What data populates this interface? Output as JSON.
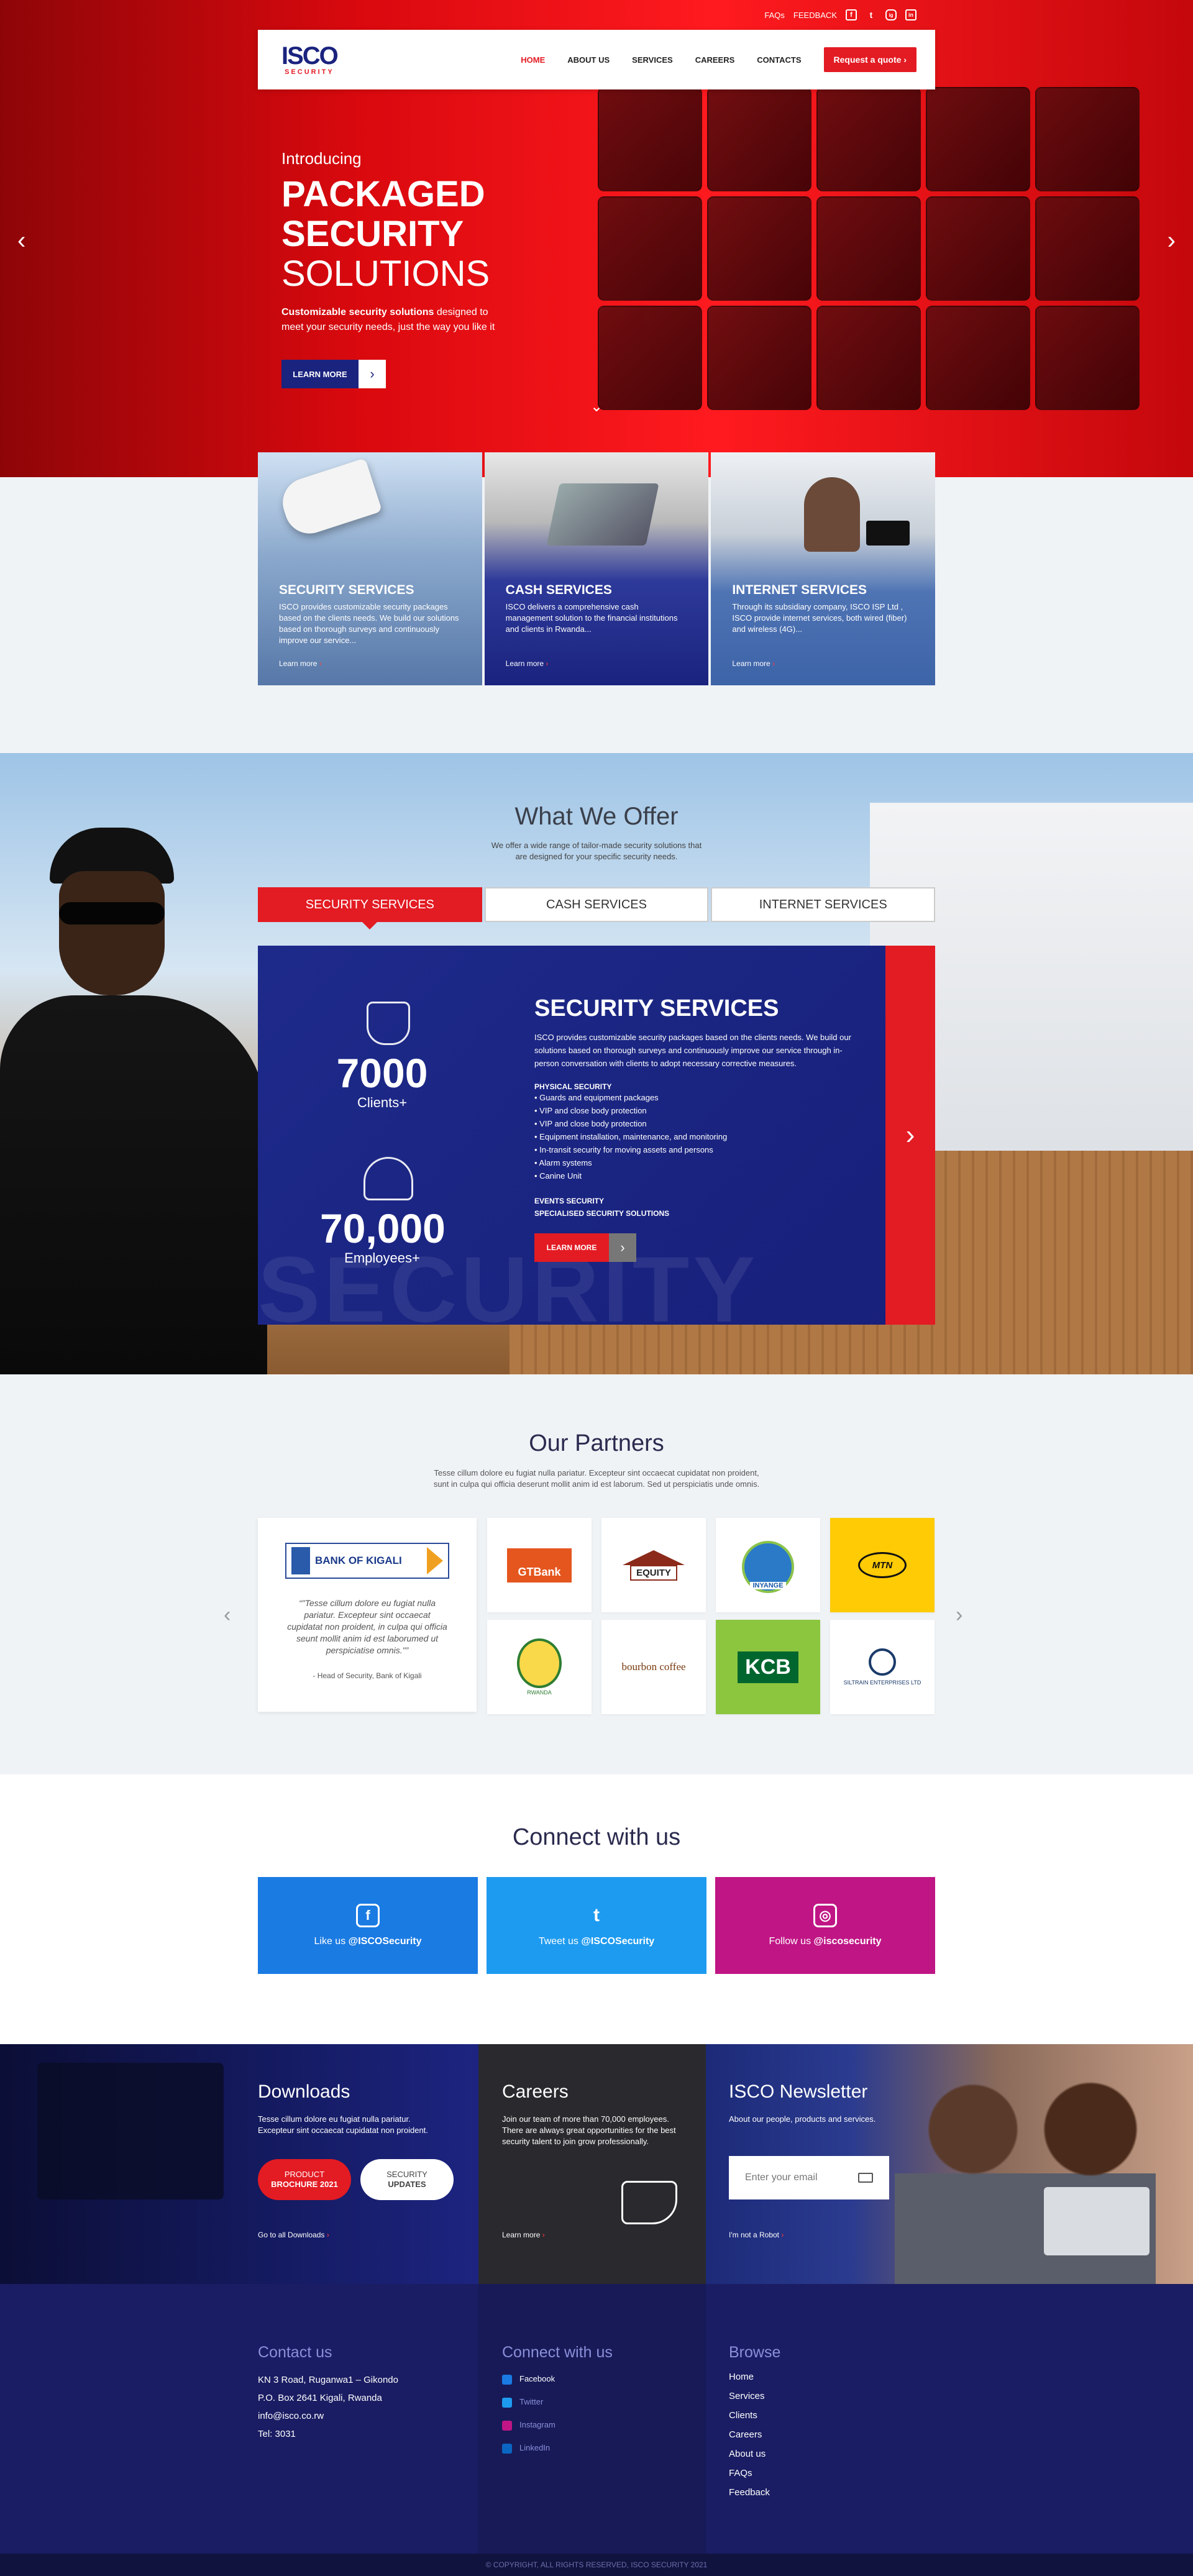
{
  "topbar": {
    "faqs": "FAQs",
    "feedback": "FEEDBACK",
    "social": [
      "f",
      "t",
      "ig",
      "in"
    ]
  },
  "nav": {
    "logo_main": "ISCO",
    "logo_sub": "SECURITY",
    "items": [
      "HOME",
      "ABOUT US",
      "SERVICES",
      "CAREERS",
      "CONTACTS"
    ],
    "active": "HOME",
    "quote": "Request a quote ›"
  },
  "hero": {
    "intro": "Introducing",
    "line1": "PACKAGED",
    "line2": "SECURITY",
    "line3": "SOLUTIONS",
    "desc_bold": "Customizable security solutions",
    "desc_rest": " designed to meet your security needs, just the way you like it",
    "cta": "LEARN MORE",
    "cta_arrow": "›",
    "prev": "‹",
    "next": "›",
    "down": "⌄"
  },
  "cards": [
    {
      "title": "SECURITY SERVICES",
      "text": "ISCO provides customizable security packages based on the clients needs. We build our solutions based on thorough surveys and continuously improve our service...",
      "link": "Learn more",
      "bg": "#6f8fb8"
    },
    {
      "title": "CASH SERVICES",
      "text": "ISCO delivers a comprehensive cash management solution to the financial institutions and clients in Rwanda...",
      "link": "Learn more",
      "bg": "#1a237e"
    },
    {
      "title": "INTERNET SERVICES",
      "text": "Through its subsidiary company, ISCO ISP Ltd , ISCO provide internet services, both wired (fiber) and wireless (4G)...",
      "link": "Learn more",
      "bg": "#3d63a8"
    }
  ],
  "offer": {
    "title": "What We Offer",
    "sub1": "We offer a wide range of tailor-made security solutions that",
    "sub2": "are designed for your specific security needs.",
    "tabs": [
      "SECURITY SERVICES",
      "CASH SERVICES",
      "INTERNET SERVICES"
    ],
    "active_tab": 0,
    "stats": [
      {
        "n": "7000",
        "l": "Clients+"
      },
      {
        "n": "70,000",
        "l": "Employees+"
      }
    ],
    "panel_title": "SECURITY SERVICES",
    "panel_text": "ISCO provides customizable security packages based on the clients needs. We build our solutions based on thorough surveys and continuously improve our service through in-person conversation with clients to adopt necessary corrective measures.",
    "physical_title": "PHYSICAL SECURITY",
    "physical_items": [
      "• Guards and equipment packages",
      "• VIP and close body protection",
      "• VIP and close body protection",
      "• Equipment installation, maintenance, and monitoring",
      "• In-transit security for moving assets and persons",
      "• Alarm systems",
      "• Canine Unit"
    ],
    "events": "EVENTS SECURITY",
    "special": "SPECIALISED SECURITY SOLUTIONS",
    "btn": "LEARN MORE",
    "btn_arrow": "›",
    "next": "›",
    "watermark": "SECURITY"
  },
  "partners": {
    "title": "Our Partners",
    "sub1": "Tesse cillum dolore eu fugiat nulla pariatur. Excepteur sint occaecat cupidatat non proident,",
    "sub2": "sunt in culpa qui officia deserunt mollit anim id est laborum. Sed ut perspiciatis unde omnis.",
    "featured": "BANK OF KIGALI",
    "quote": "\"Tesse cillum dolore eu fugiat nulla pariatur. Excepteur sint occaecat cupidatat non proident, in culpa qui officia seunt mollit anim id est laborumed ut perspiciatise omnis.\"",
    "who": "- Head of Security, Bank of Kigali",
    "logos": [
      "GTBank",
      "EQUITY",
      "INYANGE",
      "MTN",
      "RWANDA",
      "bourbon coffee",
      "KCB",
      "SILTRAIN ENTERPRISES LTD"
    ],
    "prev": "‹",
    "next": "›"
  },
  "connect": {
    "title": "Connect with us",
    "boxes": [
      {
        "pre": "Like us ",
        "handle": "@ISCOSecurity",
        "icon": "f",
        "color": "#1a7be3"
      },
      {
        "pre": "Tweet us ",
        "handle": "@ISCOSecurity",
        "icon": "t",
        "color": "#1d9bf0"
      },
      {
        "pre": "Follow us ",
        "handle": "@iscosecurity",
        "icon": "◎",
        "color": "#c01585"
      }
    ]
  },
  "band": {
    "downloads": {
      "title": "Downloads",
      "text": "Tesse cillum dolore eu fugiat nulla pariatur. Excepteur sint occaecat cupidatat non proident.",
      "p1a": "PRODUCT",
      "p1b": "BROCHURE 2021",
      "p2a": "SECURITY",
      "p2b": "UPDATES",
      "link": "Go to all Downloads"
    },
    "careers": {
      "title": "Careers",
      "text": "Join our team of more than 70,000 employees. There are always great opportunities for the best security talent to join grow professionally.",
      "link": "Learn more"
    },
    "newsletter": {
      "title": "ISCO Newsletter",
      "text": "About our people, products and services.",
      "placeholder": "Enter your email",
      "robot": "I'm not a Robot"
    }
  },
  "footer": {
    "contact_title": "Contact us",
    "contact": [
      "KN 3 Road, Ruganwa1 – Gikondo",
      "P.O. Box 2641 Kigali, Rwanda",
      "info@isco.co.rw",
      "Tel: 3031"
    ],
    "connect_title": "Connect with us",
    "social": [
      {
        "label": "Facebook",
        "color": "#1a7be3"
      },
      {
        "label": "Twitter",
        "color": "#1d9bf0"
      },
      {
        "label": "Instagram",
        "color": "#c01585"
      },
      {
        "label": "LinkedIn",
        "color": "#0a66c2"
      }
    ],
    "browse_title": "Browse",
    "browse": [
      "Home",
      "Services",
      "Clients",
      "Careers",
      "About us",
      "FAQs",
      "Feedback"
    ],
    "copyright": "© COPYRIGHT, ALL RIGHTS RESERVED, ISCO SECURITY 2021"
  }
}
